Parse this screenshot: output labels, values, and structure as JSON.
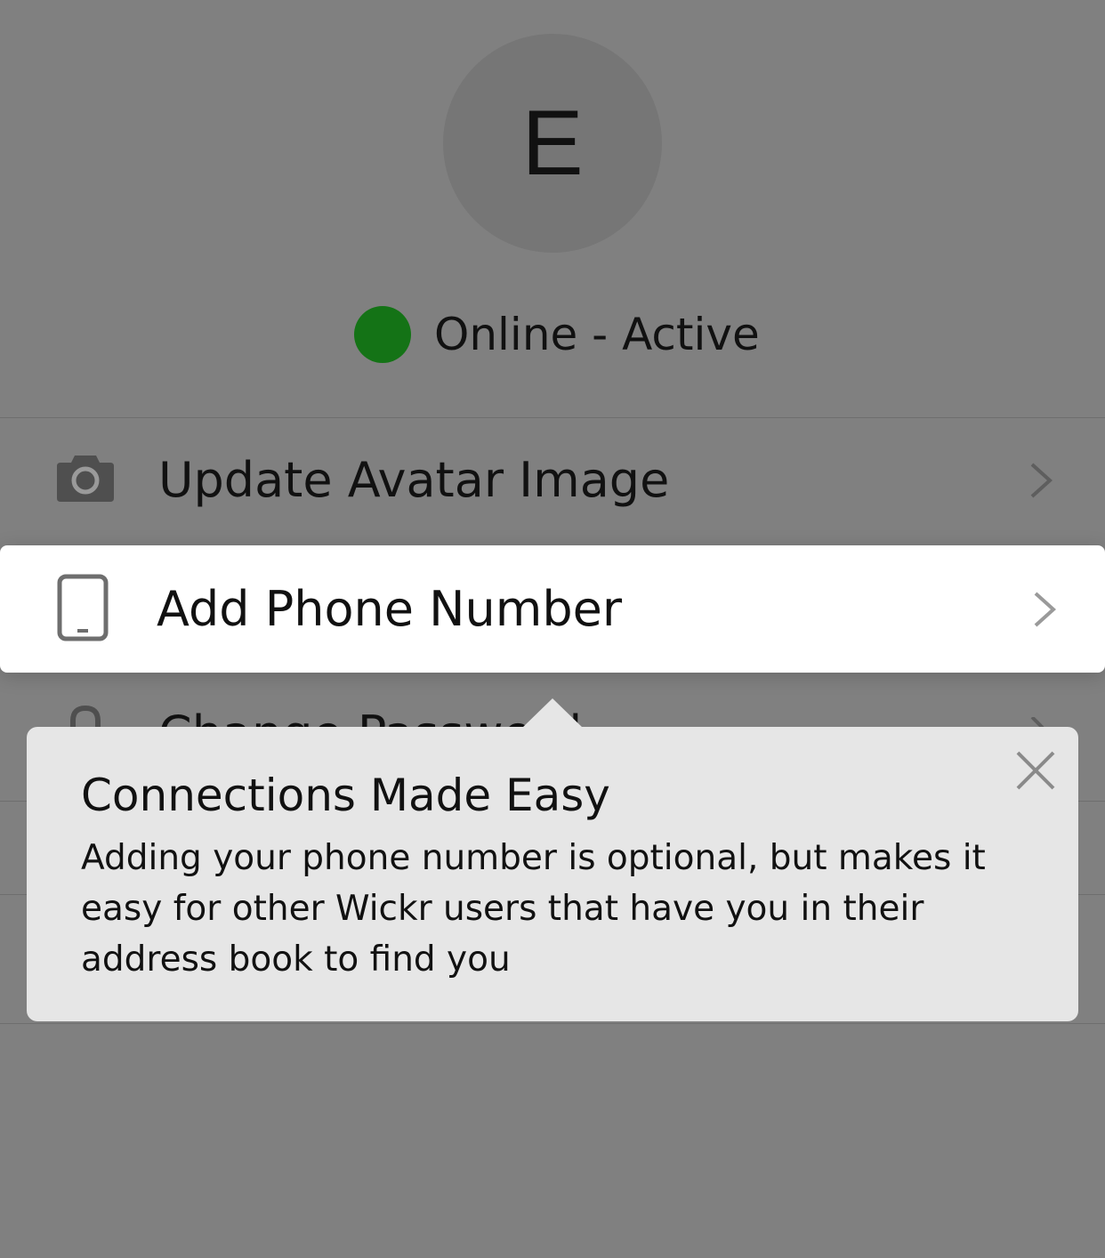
{
  "profile": {
    "avatar_initial": "E",
    "status_label": "Online - Active",
    "status_color": "#147316"
  },
  "menu": {
    "items": [
      {
        "label": "Update Avatar Image",
        "icon": "camera-icon"
      },
      {
        "label": "Add Phone Number",
        "icon": "tablet-icon"
      },
      {
        "label": "Change Password",
        "icon": "lock-icon"
      }
    ]
  },
  "tooltip": {
    "title": "Connections Made Easy",
    "body": "Adding your phone number is optional, but makes it easy for other Wickr users that have you in their address book to find you",
    "close_icon": "close-icon"
  }
}
